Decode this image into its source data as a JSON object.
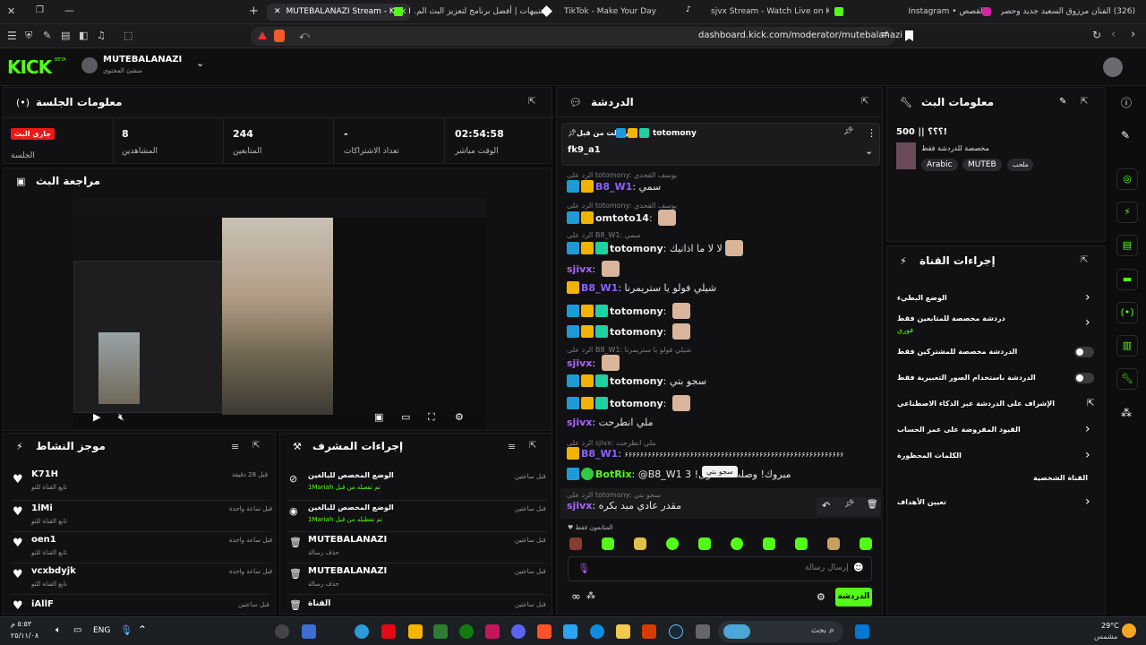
{
  "browser": {
    "tabs": [
      {
        "label": "MUTEBALANAZI Stream - Kick D"
      },
      {
        "label": "التنبيهات | أفضل برنامج لتعزيز البث الم..."
      },
      {
        "label": "TikTok - Make Your Day"
      },
      {
        "label": "sjvx Stream - Watch Live on Kick"
      },
      {
        "label": "القصص • Instagram"
      },
      {
        "label": "(326) الفنان مرزوق السعيد جديد وحصري..."
      }
    ],
    "url": "dashboard.kick.com/moderator/mutebalanazi"
  },
  "header": {
    "logo": "KICK",
    "logo_beta": "BETA",
    "channel_name": "MUTEBALANAZI",
    "channel_role": "منشئ المحتوى"
  },
  "session": {
    "title": "معلومات الجلسة",
    "live_badge": "جاري البث",
    "session_label": "الجلسة",
    "stats": [
      {
        "value": "8",
        "label": "المشاهدين"
      },
      {
        "value": "244",
        "label": "المتابعين"
      },
      {
        "value": "-",
        "label": "تعداد الاشتراكات"
      },
      {
        "value": "02:54:58",
        "label": "الوقت مباشر"
      }
    ]
  },
  "preview": {
    "title": "مراجعة البث"
  },
  "activity": {
    "title": "موجز النشاط",
    "items": [
      {
        "name": "K71H",
        "sub": "تابع القناة للتو",
        "time": "قبل 28 دقيقة"
      },
      {
        "name": "1lMi",
        "sub": "تابع القناة للتو",
        "time": "قبل ساعة واحدة"
      },
      {
        "name": "oen1",
        "sub": "تابع القناة للتو",
        "time": "قبل ساعة واحدة"
      },
      {
        "name": "vcxbdyjk",
        "sub": "تابع القناة للتو",
        "time": "قبل ساعة واحدة"
      },
      {
        "name": "iAllF",
        "sub": "",
        "time": "قبل ساعتين"
      }
    ]
  },
  "modactions": {
    "title": "إجراءات المشرف",
    "items": [
      {
        "name": "الوضع المخصص للبالغين",
        "sub": "1Mariah تم تفعيله من قبل",
        "time": "قبل ساعتين"
      },
      {
        "name": "الوضع المخصص للبالغين",
        "sub": "1Mariah تم تعطيله من قبل",
        "time": "قبل ساعتين"
      },
      {
        "name": "MUTEBALANAZI",
        "sub": "حذف رسالة",
        "time": "قبل ساعتين"
      },
      {
        "name": "MUTEBALANAZI",
        "sub": "حذف رسالة",
        "time": "قبل ساعتين"
      },
      {
        "name": "القناة",
        "sub": "",
        "time": "قبل ساعتين"
      }
    ]
  },
  "chat": {
    "title": "الدردشة",
    "pinned": {
      "label": "أرسلت من قبل",
      "user": "totomony",
      "text": "fk9_a1"
    },
    "replies": [
      "الرد على totomony: يوسف القحدي",
      "الرد على totomony: يوسف القحدي",
      "الرد على B8_W1: سمي",
      "الرد على B8_W1: شيلي فولو يا ستريمرنا",
      "الرد على sjivx: ملي انطرحت",
      "الرد على totomony: سجو بتي"
    ],
    "messages": [
      {
        "user": "B8_W1",
        "text": "سمي"
      },
      {
        "user": "omtoto14",
        "text": ""
      },
      {
        "user": "totomony",
        "text": "لا لا ما اذانيك"
      },
      {
        "user": "sjivx",
        "text": ""
      },
      {
        "user": "B8_W1",
        "text": "شيلي فولو يا ستريمرنا"
      },
      {
        "user": "totomony",
        "text": ""
      },
      {
        "user": "totomony",
        "text": ""
      },
      {
        "user": "sjivx",
        "text": ""
      },
      {
        "user": "totomony",
        "text": "سجو بتي"
      },
      {
        "user": "totomony",
        "text": ""
      },
      {
        "user": "sjivx",
        "text": "ملي انطرحت"
      },
      {
        "user": "B8_W1",
        "text": "۶۶۶۶۶۶۶۶۶۶۶۶۶۶۶۶۶۶۶۶۶۶۶۶۶۶۶۶۶۶۶۶۶۶۶۶۶۶۶۶۶۶۶۶۶۶۶۶۶۶۶۶۶۶۶۶۶۶۶۶"
      },
      {
        "user": "BotRix",
        "text": "@B8_W1 3 !مبروك! وصلت مستوى"
      },
      {
        "user": "sjivx",
        "text": "مقدر عادي مبد بكره"
      }
    ],
    "tooltip": "سجو بتي",
    "followers_only": "المتابعون فقط",
    "input_placeholder": "إرسال رسالة",
    "send_label": "الدردشة"
  },
  "streaminfo": {
    "title": "معلومات البث",
    "stream_title": "؟؟؟ || 500!",
    "category": "مخصصة للدردشة فقط",
    "tags": [
      "Arabic",
      "MUTEB",
      "ملحب"
    ]
  },
  "channel_actions": {
    "title": "إجراءات القناة",
    "items": [
      {
        "label": "الوضع البطيء"
      },
      {
        "label": "دردشة مخصصة للمتابعين فقط",
        "sub": "فوري"
      },
      {
        "label": "الدردشة مخصصة للمشتركين فقط"
      },
      {
        "label": "الدردشة باستخدام الصور التعبيرية فقط"
      },
      {
        "label": "الإشراف على الدردشة عبر الذكاء الاصطناعي"
      },
      {
        "label": "القيود المفروضة على عمر الحساب"
      },
      {
        "label": "الكلمات المحظورة"
      },
      {
        "label": "القناة الشخصية"
      },
      {
        "label": "تعيين الأهداف"
      }
    ]
  },
  "taskbar": {
    "time": "٥:٥٣ م",
    "date": "٢٥/١١/٠٨",
    "lang": "ENG",
    "search_placeholder": "بحث",
    "weather_temp": "29°C",
    "weather_desc": "مشمس"
  }
}
